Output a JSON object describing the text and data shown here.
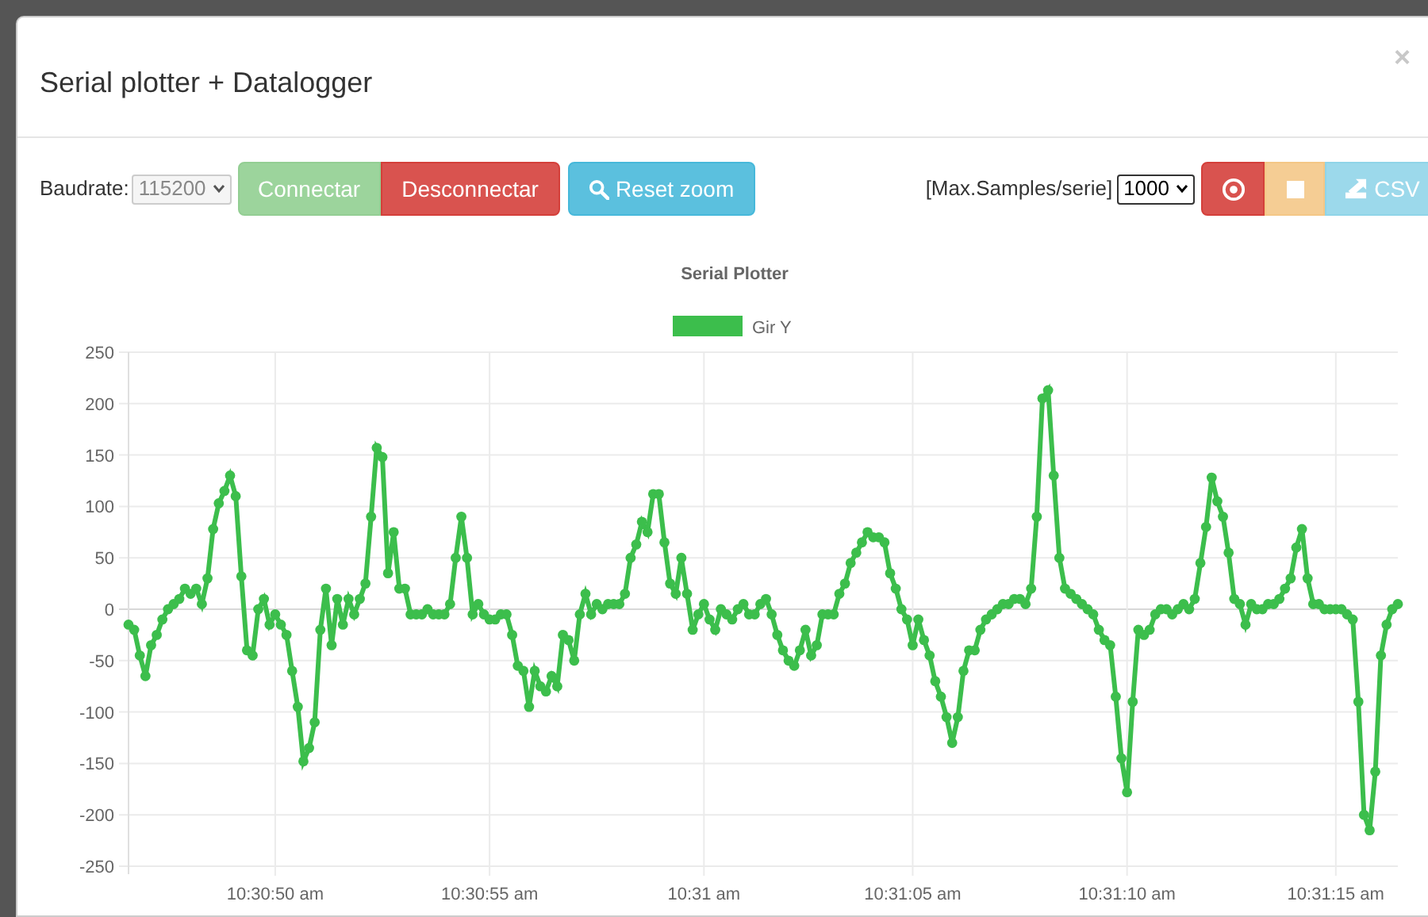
{
  "window": {
    "title": "Serial plotter + Datalogger",
    "close": "×"
  },
  "toolbar": {
    "baudrate_label": "Baudrate:",
    "baudrate": {
      "value": "115200",
      "disabled": true
    },
    "buttons": [
      {
        "kind": "connect",
        "label": "Connectar",
        "disabled": true
      },
      {
        "kind": "disconnect",
        "label": "Desconnectar",
        "disabled": false
      },
      {
        "kind": "reset",
        "label": "Reset zoom",
        "disabled": false
      }
    ],
    "max_samples_label": "[Max.Samples/serie]",
    "max_samples": {
      "value": "1000"
    },
    "record_buttons": [
      {
        "kind": "record",
        "disabled": false
      },
      {
        "kind": "stop",
        "disabled": true
      },
      {
        "kind": "csv",
        "label": "CSV",
        "disabled": true
      }
    ]
  },
  "chart": {
    "chart_data": {
      "type": "line",
      "title": "Serial Plotter",
      "grid": true,
      "categories": [
        null,
        null,
        null,
        null,
        null,
        null,
        null,
        null,
        null,
        null,
        null,
        null,
        null,
        null,
        null,
        null,
        null,
        null,
        null,
        null,
        null,
        null,
        null,
        null,
        null,
        null,
        "10:30:50 am",
        null,
        null,
        null,
        null,
        null,
        null,
        null,
        null,
        null,
        null,
        null,
        null,
        null,
        null,
        null,
        null,
        null,
        null,
        null,
        null,
        null,
        null,
        null,
        null,
        null,
        null,
        null,
        null,
        null,
        null,
        null,
        null,
        null,
        null,
        null,
        null,
        null,
        "10:30:55 am",
        null,
        null,
        null,
        null,
        null,
        null,
        null,
        null,
        null,
        null,
        null,
        null,
        null,
        null,
        null,
        null,
        null,
        null,
        null,
        null,
        null,
        null,
        null,
        null,
        null,
        null,
        null,
        null,
        null,
        null,
        null,
        null,
        null,
        null,
        null,
        null,
        null,
        "10:31 am",
        null,
        null,
        null,
        null,
        null,
        null,
        null,
        null,
        null,
        null,
        null,
        null,
        null,
        null,
        null,
        null,
        null,
        null,
        null,
        null,
        null,
        null,
        null,
        null,
        null,
        null,
        null,
        null,
        null,
        null,
        null,
        null,
        null,
        null,
        null,
        null,
        "10:31:05 am",
        null,
        null,
        null,
        null,
        null,
        null,
        null,
        null,
        null,
        null,
        null,
        null,
        null,
        null,
        null,
        null,
        null,
        null,
        null,
        null,
        null,
        null,
        null,
        null,
        null,
        null,
        null,
        null,
        null,
        null,
        null,
        null,
        null,
        null,
        null,
        null,
        null,
        "10:31:10 am",
        null,
        null,
        null,
        null,
        null,
        null,
        null,
        null,
        null,
        null,
        null,
        null,
        null,
        null,
        null,
        null,
        null,
        null,
        null,
        null,
        null,
        null,
        null,
        null,
        null,
        null,
        null,
        null,
        null,
        null,
        null,
        null,
        null,
        null,
        null,
        null,
        "10:31:15 am",
        null,
        null,
        null,
        null,
        null,
        null,
        null,
        null,
        null,
        null,
        null
      ],
      "ylim": [
        -250,
        250
      ],
      "yticks": [
        -250,
        -200,
        -150,
        -100,
        -50,
        0,
        50,
        100,
        150,
        200,
        250
      ],
      "series": [
        {
          "name": "Gir Y",
          "color": "#3cbe4c",
          "marker": "circle",
          "values": [
            -15,
            -20,
            -45,
            -65,
            -35,
            -25,
            -10,
            0,
            5,
            10,
            20,
            15,
            20,
            5,
            30,
            78,
            103,
            115,
            130,
            110,
            32,
            -40,
            -45,
            0,
            10,
            -15,
            -5,
            -15,
            -25,
            -60,
            -95,
            -148,
            -135,
            -110,
            -20,
            20,
            -35,
            10,
            -15,
            10,
            -5,
            10,
            25,
            90,
            157,
            148,
            35,
            75,
            20,
            20,
            -5,
            -5,
            -5,
            0,
            -5,
            -5,
            -5,
            5,
            50,
            90,
            50,
            -5,
            5,
            -5,
            -10,
            -10,
            -5,
            -5,
            -25,
            -55,
            -60,
            -95,
            -60,
            -75,
            -80,
            -65,
            -75,
            -25,
            -30,
            -50,
            -5,
            15,
            -5,
            5,
            0,
            5,
            5,
            5,
            15,
            50,
            63,
            85,
            75,
            112,
            112,
            65,
            25,
            15,
            50,
            15,
            -20,
            -5,
            5,
            -10,
            -20,
            0,
            -5,
            -10,
            0,
            5,
            -5,
            -5,
            5,
            10,
            -5,
            -25,
            -40,
            -50,
            -55,
            -40,
            -20,
            -45,
            -35,
            -5,
            -5,
            -5,
            15,
            25,
            45,
            55,
            65,
            75,
            70,
            70,
            65,
            35,
            20,
            0,
            -10,
            -35,
            -10,
            -30,
            -45,
            -70,
            -85,
            -105,
            -130,
            -105,
            -60,
            -40,
            -40,
            -20,
            -10,
            -5,
            0,
            5,
            5,
            10,
            10,
            5,
            20,
            90,
            205,
            213,
            130,
            50,
            20,
            15,
            10,
            5,
            0,
            -5,
            -20,
            -30,
            -35,
            -85,
            -145,
            -178,
            -90,
            -20,
            -25,
            -20,
            -5,
            0,
            0,
            -5,
            0,
            5,
            0,
            10,
            45,
            80,
            128,
            105,
            90,
            55,
            10,
            5,
            -15,
            5,
            0,
            0,
            5,
            5,
            10,
            20,
            30,
            60,
            78,
            30,
            5,
            5,
            0,
            0,
            0,
            0,
            -5,
            -10,
            -90,
            -200,
            -215,
            -158,
            -45,
            -15,
            0,
            5
          ]
        }
      ]
    }
  }
}
